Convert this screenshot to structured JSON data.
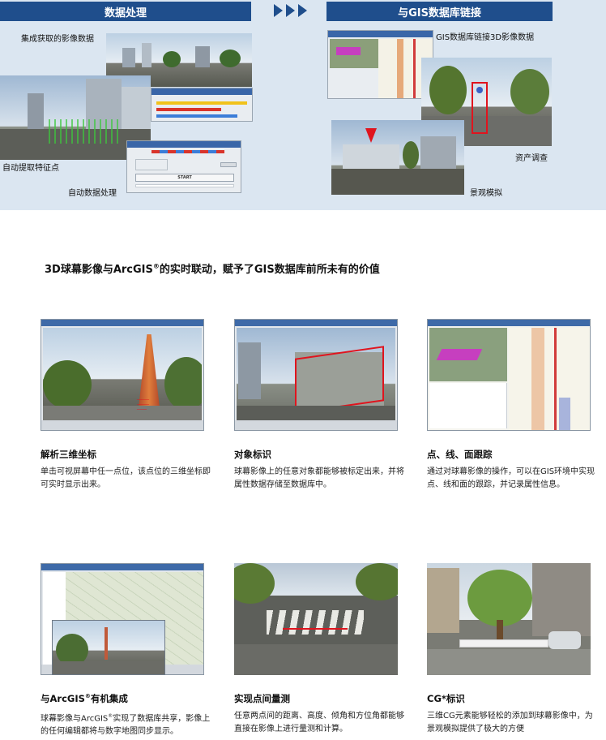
{
  "banner": {
    "left_header": "数据处理",
    "right_header": "与GIS数据库链接",
    "labels": {
      "integrate": "集成获取的影像数据",
      "extract": "自动提取特征点",
      "auto_process": "自动数据处理",
      "gis_link": "GIS数据库链接3D影像数据",
      "asset": "资产调查",
      "landscape": "景观模拟"
    },
    "dialog_start": "START"
  },
  "headline": {
    "before": "3D球幕影像与ArcGIS",
    "reg": "®",
    "after": "的实时联动，赋予了GIS数据库前所未有的价值"
  },
  "cards": [
    {
      "title": "解析三维坐标",
      "desc": "单击可视屏幕中任一点位，该点位的三维坐标即可实时显示出来。"
    },
    {
      "title": "对象标识",
      "desc": "球幕影像上的任意对象都能够被标定出来，并将属性数据存储至数据库中。"
    },
    {
      "title": "点、线、面跟踪",
      "desc": "通过对球幕影像的操作，可以在GIS环境中实现点、线和面的跟踪，并记录属性信息。"
    },
    {
      "title_before": "与ArcGIS",
      "title_reg": "®",
      "title_after": "有机集成",
      "desc_before": "球幕影像与ArcGIS",
      "desc_reg": "®",
      "desc_after": "实现了数据库共享，影像上的任何编辑都将与数字地图同步显示。"
    },
    {
      "title": "实现点间量测",
      "desc": "任意两点间的距离、高度、倾角和方位角都能够直接在影像上进行量测和计算。"
    },
    {
      "title": "CG*标识",
      "desc": "三维CG元素能够轻松的添加到球幕影像中，为景观模拟提供了极大的方便"
    }
  ],
  "colors": {
    "banner_bg": "#dbe6f1",
    "header_blue": "#1f4e8c",
    "highlight_red": "#e0141e"
  }
}
